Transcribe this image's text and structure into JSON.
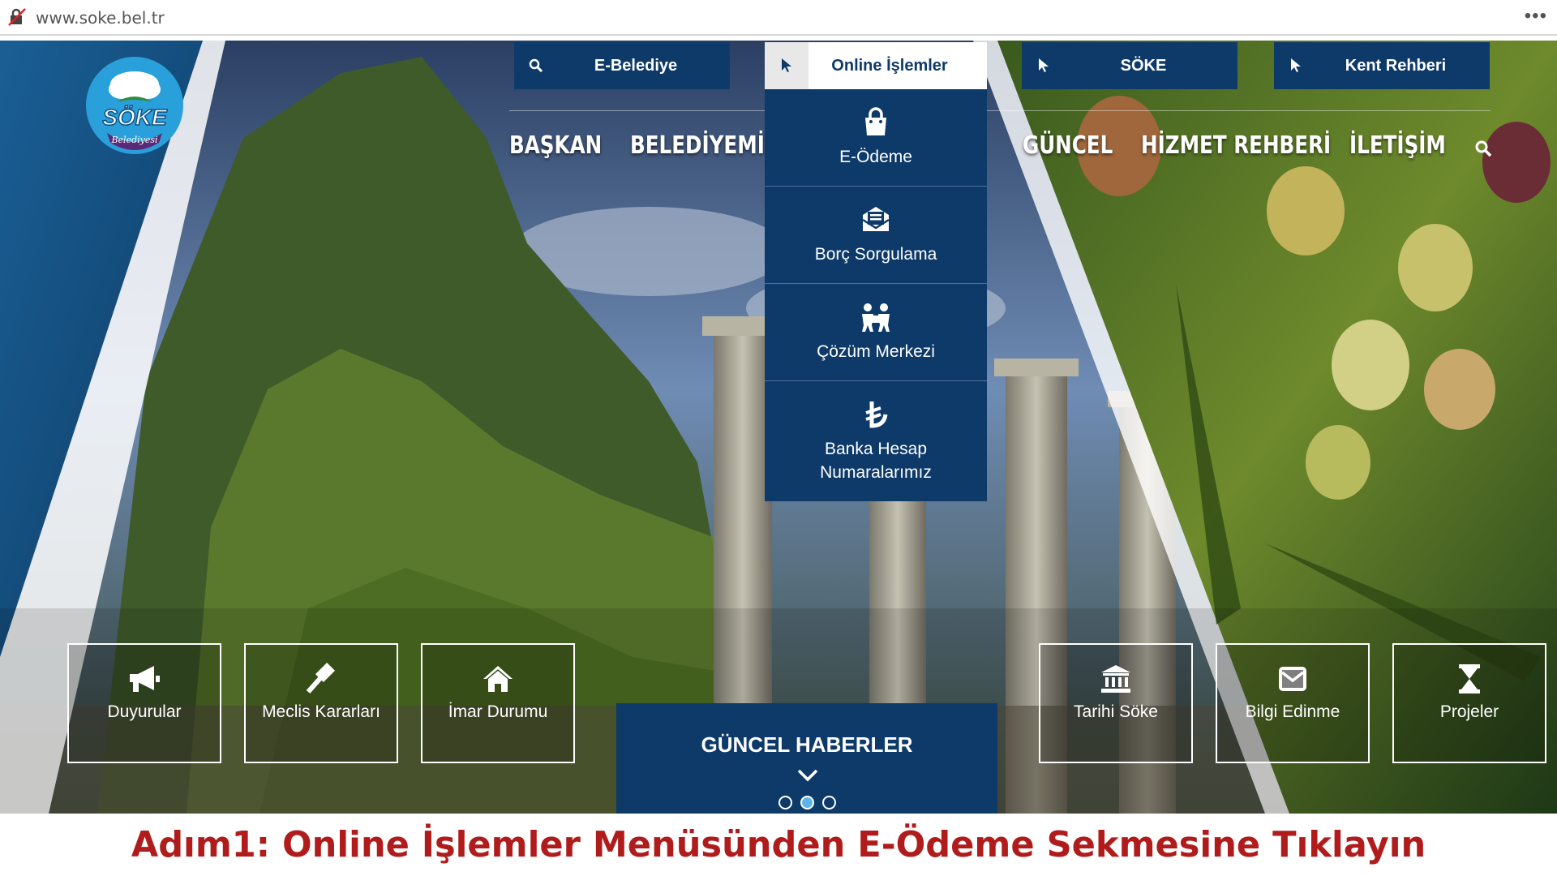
{
  "browser": {
    "url": "www.soke.bel.tr",
    "menu_glyph": "•••"
  },
  "logo": {
    "name": "SÖKE",
    "sub": "Belediyesi"
  },
  "top_buttons": [
    {
      "label": "E-Belediye",
      "icon": "search-icon"
    },
    {
      "label": "Online İşlemler",
      "icon": "cursor-icon",
      "active": true
    },
    {
      "label": "SÖKE",
      "icon": "cursor-icon"
    },
    {
      "label": "Kent Rehberi",
      "icon": "cursor-icon"
    }
  ],
  "main_nav": [
    "BAŞKAN",
    "BELEDİYEMİZ",
    "GÜNCEL",
    "HİZMET REHBERİ",
    "İLETİŞİM"
  ],
  "dropdown": [
    {
      "label": "E-Ödeme",
      "icon": "shopping-bag-icon"
    },
    {
      "label": "Borç Sorgulama",
      "icon": "document-icon"
    },
    {
      "label": "Çözüm Merkezi",
      "icon": "people-icon"
    },
    {
      "label": "Banka Hesap Numaralarımız",
      "icon": "lira-icon"
    }
  ],
  "tiles": [
    {
      "label": "Duyurular",
      "icon": "megaphone-icon"
    },
    {
      "label": "Meclis Kararları",
      "icon": "gavel-icon"
    },
    {
      "label": "İmar Durumu",
      "icon": "home-icon"
    },
    {
      "label": "Tarihi Söke",
      "icon": "institution-icon"
    },
    {
      "label": "Bilgi Edinme",
      "icon": "envelope-icon"
    },
    {
      "label": "Projeler",
      "icon": "hourglass-icon"
    }
  ],
  "news": {
    "title": "GÜNCEL HABERLER",
    "slides": 3,
    "active_slide": 2
  },
  "caption": "Adım1: Online İşlemler Menüsünden E-Ödeme Sekmesine Tıklayın",
  "colors": {
    "navy": "#0e3a6a",
    "caption_red": "#b01c1c",
    "dot_active": "#5db4e8"
  }
}
